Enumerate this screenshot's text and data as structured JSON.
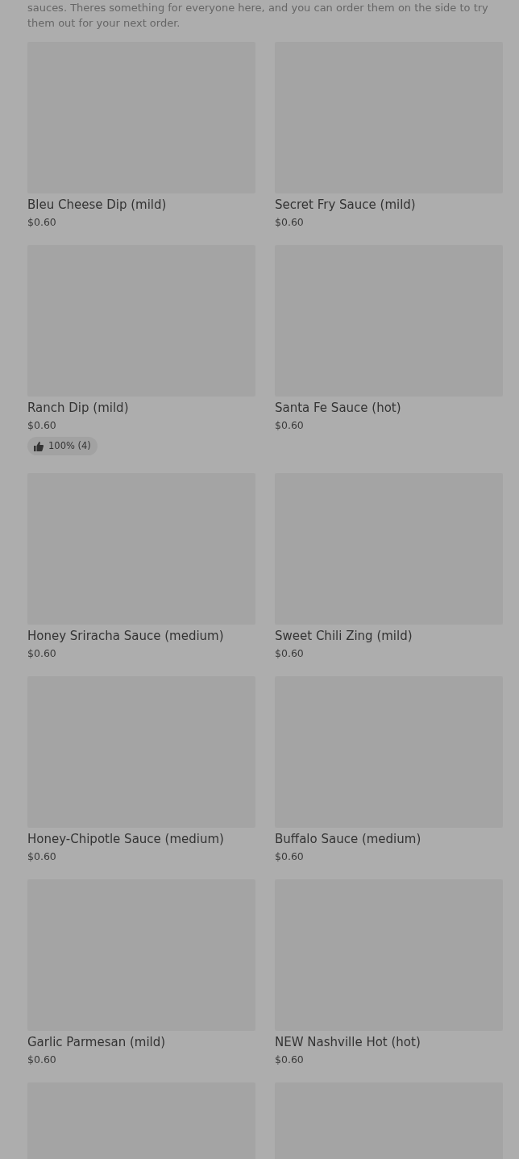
{
  "description": "sauces. Theres something for everyone here, and you can order them on the side to try them out for your next order.",
  "items": [
    {
      "kind": "item",
      "name": "Bleu Cheese Dip (mild)",
      "price": "$0.60"
    },
    {
      "kind": "item",
      "name": "Secret Fry Sauce (mild)",
      "price": "$0.60"
    },
    {
      "kind": "item",
      "name": "Ranch Dip (mild)",
      "price": "$0.60",
      "rating": "100% (4)"
    },
    {
      "kind": "item",
      "name": "Santa Fe Sauce (hot)",
      "price": "$0.60"
    },
    {
      "kind": "item",
      "name": "Honey Sriracha Sauce (medium)",
      "price": "$0.60"
    },
    {
      "kind": "item",
      "name": "Sweet Chili Zing (mild)",
      "price": "$0.60"
    },
    {
      "kind": "item",
      "name": "Honey-Chipotle Sauce (medium)",
      "price": "$0.60"
    },
    {
      "kind": "item",
      "name": "Buffalo Sauce (medium)",
      "price": "$0.60"
    },
    {
      "kind": "item",
      "name": "Garlic Parmesan (mild)",
      "price": "$0.60"
    },
    {
      "kind": "item",
      "name": "NEW Nashville Hot (hot)",
      "price": "$0.60"
    },
    {
      "kind": "cut"
    },
    {
      "kind": "cut"
    }
  ]
}
